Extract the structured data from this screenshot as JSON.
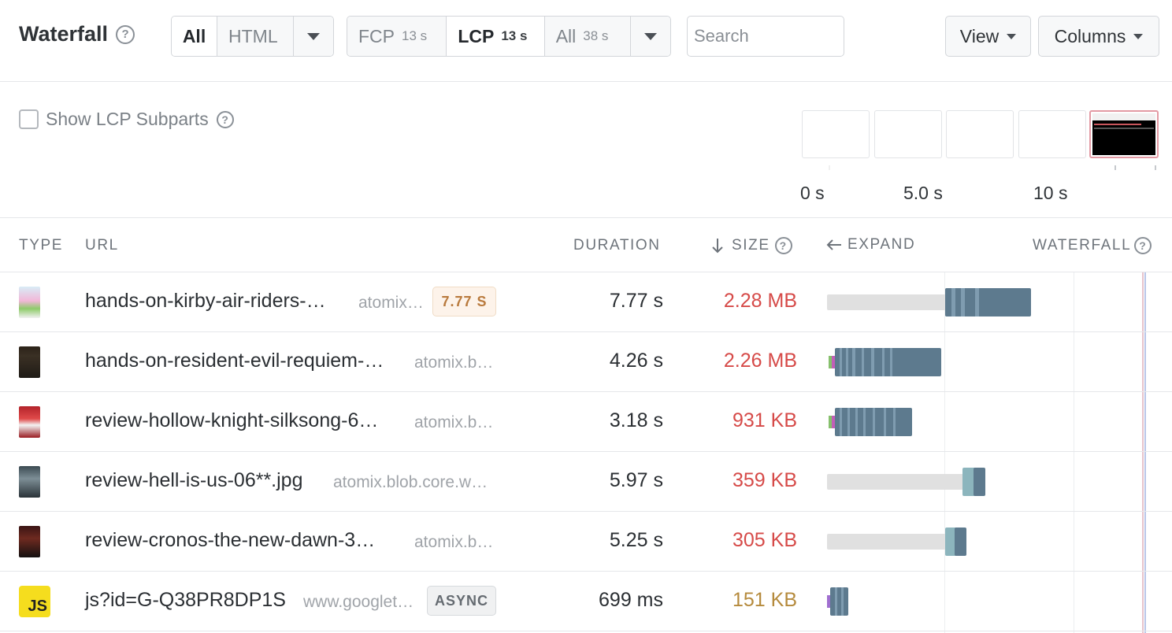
{
  "header": {
    "title": "Waterfall",
    "filter_type": {
      "options": [
        "All",
        "HTML"
      ],
      "selected": "All"
    },
    "milestones": [
      {
        "label": "FCP",
        "value": "13 s"
      },
      {
        "label": "LCP",
        "value": "13 s",
        "active": true
      },
      {
        "label": "All",
        "value": "38 s"
      }
    ],
    "search_placeholder": "Search",
    "view_label": "View",
    "columns_label": "Columns"
  },
  "subparts": {
    "label": "Show LCP Subparts",
    "checked": false
  },
  "timeline": {
    "labels": [
      "0 s",
      "5.0 s",
      "10 s"
    ]
  },
  "table": {
    "headers": {
      "type": "TYPE",
      "url": "URL",
      "duration": "DURATION",
      "size": "SIZE",
      "expand": "EXPAND",
      "waterfall": "WATERFALL"
    },
    "rows": [
      {
        "name": "hands-on-kirby-air-riders-…",
        "host": "atomix…",
        "badge": "7.77 S",
        "duration": "7.77 s",
        "size": "2.28 MB",
        "size_color": "#d64a48"
      },
      {
        "name": "hands-on-resident-evil-requiem-…",
        "host": "atomix.b…",
        "badge": "",
        "duration": "4.26 s",
        "size": "2.26 MB",
        "size_color": "#d64a48"
      },
      {
        "name": "review-hollow-knight-silksong-6…",
        "host": "atomix.b…",
        "badge": "",
        "duration": "3.18 s",
        "size": "931 KB",
        "size_color": "#d64a48"
      },
      {
        "name": "review-hell-is-us-06**.jpg",
        "host": "atomix.blob.core.w…",
        "badge": "",
        "duration": "5.97 s",
        "size": "359 KB",
        "size_color": "#d64a48"
      },
      {
        "name": "review-cronos-the-new-dawn-3…",
        "host": "atomix.b…",
        "badge": "",
        "duration": "5.25 s",
        "size": "305 KB",
        "size_color": "#d64a48"
      },
      {
        "name": "js?id=G-Q38PR8DP1S",
        "host": "www.googlet…",
        "badge": "ASYNC",
        "duration": "699 ms",
        "size": "151 KB",
        "size_color": "#b58a3c",
        "icon_text": "JS"
      }
    ]
  }
}
